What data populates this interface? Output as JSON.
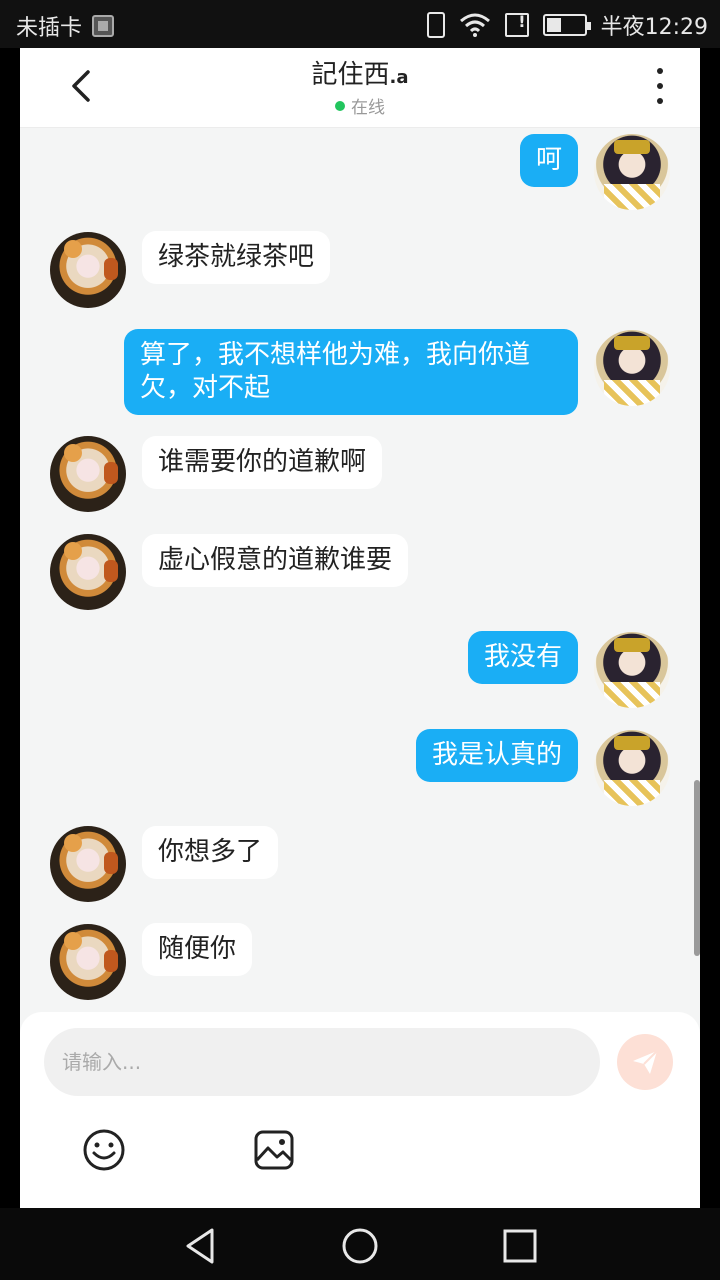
{
  "status_bar": {
    "carrier": "未插卡",
    "time": "半夜12:29",
    "battery_level": 0.35
  },
  "header": {
    "title": "記住西",
    "title_suffix": ".a",
    "status": "在线"
  },
  "messages": [
    {
      "side": "self",
      "text": "呵"
    },
    {
      "side": "other",
      "text": "绿茶就绿茶吧"
    },
    {
      "side": "self",
      "text": "算了，我不想样他为难，我向你道欠，对不起"
    },
    {
      "side": "other",
      "text": "谁需要你的道歉啊"
    },
    {
      "side": "other",
      "text": "虚心假意的道歉谁要"
    },
    {
      "side": "self",
      "text": "我没有"
    },
    {
      "side": "self",
      "text": "我是认真的"
    },
    {
      "side": "other",
      "text": "你想多了"
    },
    {
      "side": "other",
      "text": "随便你"
    }
  ],
  "composer": {
    "placeholder": "请输入...",
    "send_color": "#fde0d6"
  },
  "colors": {
    "self_bubble": "#1aaef5",
    "other_bubble": "#ffffff",
    "chat_bg": "#f4f5f5",
    "online": "#22c55e"
  },
  "icons": {
    "back": "chevron-left-icon",
    "more": "more-vertical-icon",
    "send": "paper-plane-icon",
    "emoji": "emoji-icon",
    "image": "image-icon",
    "nav_back": "triangle-back-icon",
    "nav_home": "circle-home-icon",
    "nav_recents": "square-recents-icon"
  }
}
